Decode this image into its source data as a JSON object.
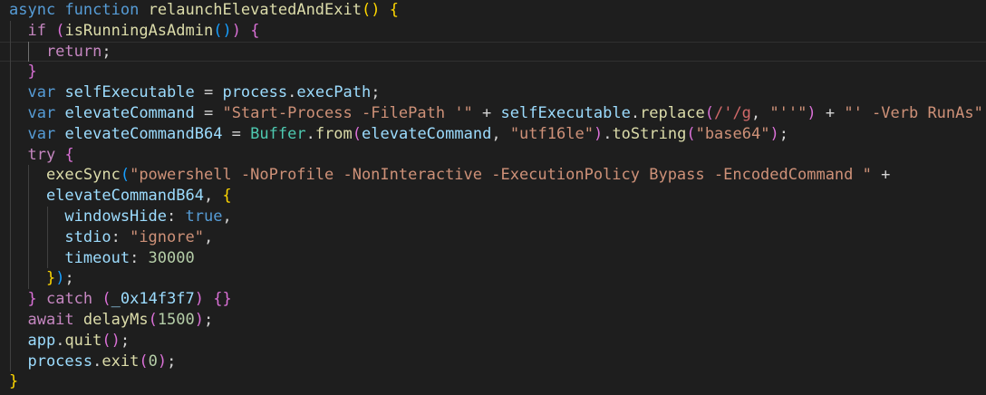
{
  "editor": {
    "theme": "dark",
    "colors": {
      "background": "#1e1e1e",
      "keyword": "#569cd6",
      "control": "#c586c0",
      "function": "#dcdcaa",
      "variable": "#9cdcfe",
      "string": "#ce9178",
      "number": "#b5cea8",
      "class": "#4ec9b0",
      "regex": "#d16969",
      "bracket_level_1": "#ffd700",
      "bracket_level_2": "#da70d6",
      "bracket_level_3": "#179fff"
    },
    "lines": [
      {
        "indent": 0,
        "tokens": [
          [
            "kw",
            "async"
          ],
          [
            "op",
            " "
          ],
          [
            "kw",
            "function"
          ],
          [
            "op",
            " "
          ],
          [
            "fn",
            "relaunchElevatedAndExit"
          ],
          [
            "b1",
            "()"
          ],
          [
            "op",
            " "
          ],
          [
            "b1",
            "{"
          ]
        ]
      },
      {
        "indent": 1,
        "tokens": [
          [
            "ctl",
            "if"
          ],
          [
            "op",
            " "
          ],
          [
            "b2",
            "("
          ],
          [
            "fn",
            "isRunningAsAdmin"
          ],
          [
            "b3",
            "()"
          ],
          [
            "b2",
            ")"
          ],
          [
            "op",
            " "
          ],
          [
            "b2",
            "{"
          ]
        ]
      },
      {
        "indent": 2,
        "current": true,
        "tokens": [
          [
            "ctl",
            "return"
          ],
          [
            "op",
            ";"
          ]
        ]
      },
      {
        "indent": 1,
        "tokens": [
          [
            "b2",
            "}"
          ]
        ]
      },
      {
        "indent": 1,
        "tokens": [
          [
            "kw",
            "var"
          ],
          [
            "op",
            " "
          ],
          [
            "var",
            "selfExecutable"
          ],
          [
            "op",
            " = "
          ],
          [
            "var",
            "process"
          ],
          [
            "op",
            "."
          ],
          [
            "var",
            "execPath"
          ],
          [
            "op",
            ";"
          ]
        ]
      },
      {
        "indent": 1,
        "tokens": [
          [
            "kw",
            "var"
          ],
          [
            "op",
            " "
          ],
          [
            "var",
            "elevateCommand"
          ],
          [
            "op",
            " = "
          ],
          [
            "str",
            "\"Start-Process -FilePath '\""
          ],
          [
            "op",
            " + "
          ],
          [
            "var",
            "selfExecutable"
          ],
          [
            "op",
            "."
          ],
          [
            "fn",
            "replace"
          ],
          [
            "b2",
            "("
          ],
          [
            "rx",
            "/'/g"
          ],
          [
            "op",
            ", "
          ],
          [
            "str",
            "\"''\""
          ],
          [
            "b2",
            ")"
          ],
          [
            "op",
            " + "
          ],
          [
            "str",
            "\"' -Verb RunAs\""
          ],
          [
            "op",
            ";"
          ]
        ]
      },
      {
        "indent": 1,
        "tokens": [
          [
            "kw",
            "var"
          ],
          [
            "op",
            " "
          ],
          [
            "var",
            "elevateCommandB64"
          ],
          [
            "op",
            " = "
          ],
          [
            "cls",
            "Buffer"
          ],
          [
            "op",
            "."
          ],
          [
            "fn",
            "from"
          ],
          [
            "b2",
            "("
          ],
          [
            "var",
            "elevateCommand"
          ],
          [
            "op",
            ", "
          ],
          [
            "str",
            "\"utf16le\""
          ],
          [
            "b2",
            ")"
          ],
          [
            "op",
            "."
          ],
          [
            "fn",
            "toString"
          ],
          [
            "b2",
            "("
          ],
          [
            "str",
            "\"base64\""
          ],
          [
            "b2",
            ")"
          ],
          [
            "op",
            ";"
          ]
        ]
      },
      {
        "indent": 1,
        "tokens": [
          [
            "ctl",
            "try"
          ],
          [
            "op",
            " "
          ],
          [
            "b2",
            "{"
          ]
        ]
      },
      {
        "indent": 2,
        "tokens": [
          [
            "fn",
            "execSync"
          ],
          [
            "b3",
            "("
          ],
          [
            "str",
            "\"powershell -NoProfile -NonInteractive -ExecutionPolicy Bypass -EncodedCommand \""
          ],
          [
            "op",
            " +"
          ]
        ]
      },
      {
        "indent": 2,
        "tokens": [
          [
            "var",
            "elevateCommandB64"
          ],
          [
            "op",
            ", "
          ],
          [
            "b1",
            "{"
          ]
        ]
      },
      {
        "indent": 3,
        "tokens": [
          [
            "var",
            "windowsHide"
          ],
          [
            "op",
            ": "
          ],
          [
            "kw",
            "true"
          ],
          [
            "op",
            ","
          ]
        ]
      },
      {
        "indent": 3,
        "tokens": [
          [
            "var",
            "stdio"
          ],
          [
            "op",
            ": "
          ],
          [
            "str",
            "\"ignore\""
          ],
          [
            "op",
            ","
          ]
        ]
      },
      {
        "indent": 3,
        "tokens": [
          [
            "var",
            "timeout"
          ],
          [
            "op",
            ": "
          ],
          [
            "num",
            "30000"
          ]
        ]
      },
      {
        "indent": 2,
        "tokens": [
          [
            "b1",
            "}"
          ],
          [
            "b3",
            ")"
          ],
          [
            "op",
            ";"
          ]
        ]
      },
      {
        "indent": 1,
        "tokens": [
          [
            "b2",
            "}"
          ],
          [
            "op",
            " "
          ],
          [
            "ctl",
            "catch"
          ],
          [
            "op",
            " "
          ],
          [
            "b2",
            "("
          ],
          [
            "var",
            "_0x14f3f7"
          ],
          [
            "b2",
            ")"
          ],
          [
            "op",
            " "
          ],
          [
            "b2",
            "{}"
          ]
        ]
      },
      {
        "indent": 1,
        "tokens": [
          [
            "ctl",
            "await"
          ],
          [
            "op",
            " "
          ],
          [
            "fn",
            "delayMs"
          ],
          [
            "b2",
            "("
          ],
          [
            "num",
            "1500"
          ],
          [
            "b2",
            ")"
          ],
          [
            "op",
            ";"
          ]
        ]
      },
      {
        "indent": 1,
        "tokens": [
          [
            "var",
            "app"
          ],
          [
            "op",
            "."
          ],
          [
            "fn",
            "quit"
          ],
          [
            "b2",
            "()"
          ],
          [
            "op",
            ";"
          ]
        ]
      },
      {
        "indent": 1,
        "tokens": [
          [
            "var",
            "process"
          ],
          [
            "op",
            "."
          ],
          [
            "fn",
            "exit"
          ],
          [
            "b2",
            "("
          ],
          [
            "num",
            "0"
          ],
          [
            "b2",
            ")"
          ],
          [
            "op",
            ";"
          ]
        ]
      },
      {
        "indent": 0,
        "tokens": [
          [
            "b1",
            "}"
          ]
        ]
      }
    ]
  }
}
